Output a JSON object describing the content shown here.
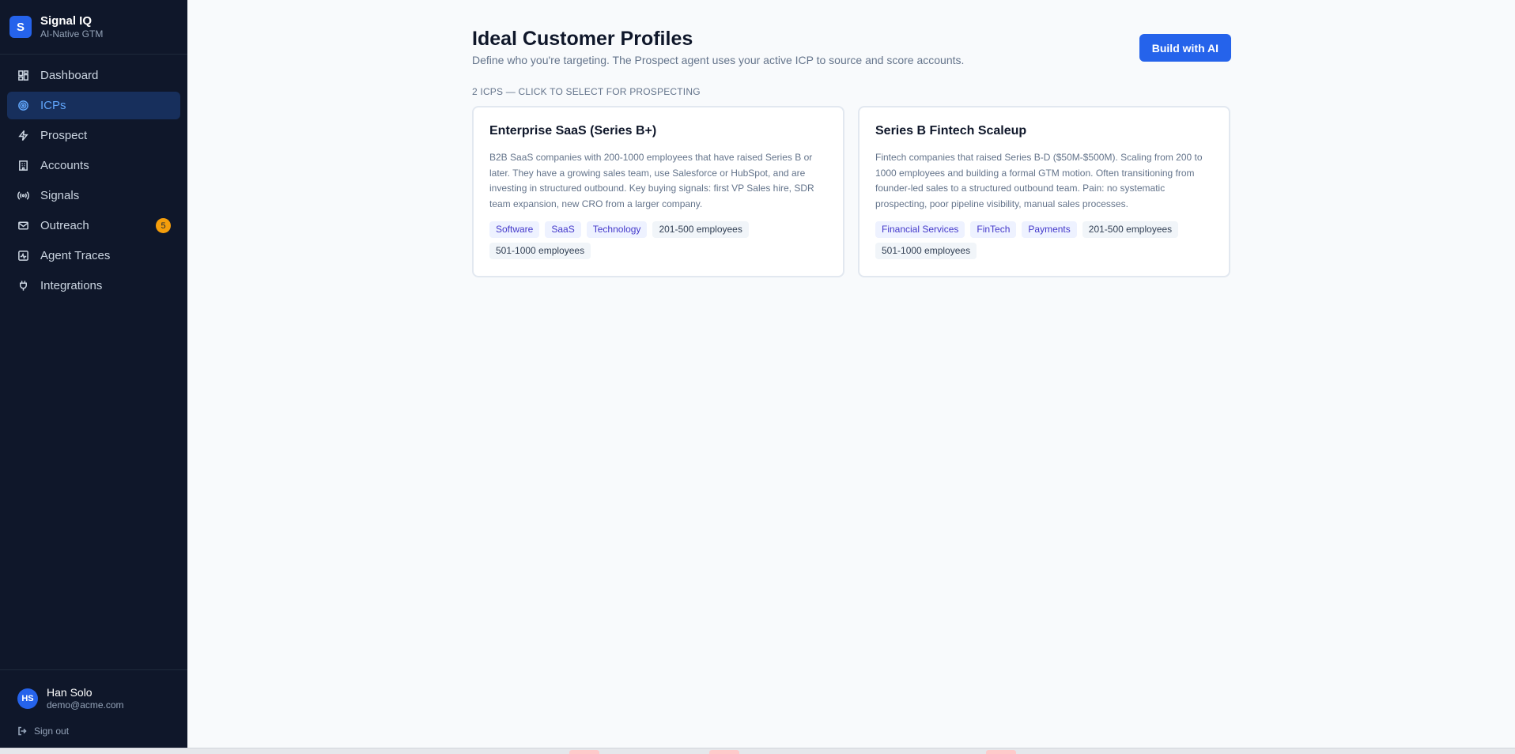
{
  "brand": {
    "logo_letter": "S",
    "name": "Signal IQ",
    "tagline": "AI-Native GTM"
  },
  "nav": [
    {
      "label": "Dashboard",
      "icon": "dashboard-icon",
      "active": false
    },
    {
      "label": "ICPs",
      "icon": "target-icon",
      "active": true
    },
    {
      "label": "Prospect",
      "icon": "bolt-icon",
      "active": false
    },
    {
      "label": "Accounts",
      "icon": "building-icon",
      "active": false
    },
    {
      "label": "Signals",
      "icon": "radio-icon",
      "active": false
    },
    {
      "label": "Outreach",
      "icon": "mail-icon",
      "active": false,
      "badge": "5"
    },
    {
      "label": "Agent Traces",
      "icon": "activity-icon",
      "active": false
    },
    {
      "label": "Integrations",
      "icon": "plug-icon",
      "active": false
    }
  ],
  "user": {
    "initials": "HS",
    "name": "Han Solo",
    "email": "demo@acme.com",
    "signout_label": "Sign out"
  },
  "page": {
    "title": "Ideal Customer Profiles",
    "description": "Define who you're targeting. The Prospect agent uses your active ICP to source and score accounts.",
    "build_button": "Build with AI",
    "section_label": "2 ICPs — click to select for prospecting"
  },
  "icps": [
    {
      "title": "Enterprise SaaS (Series B+)",
      "description": "B2B SaaS companies with 200-1000 employees that have raised Series B or later. They have a growing sales team, use Salesforce or HubSpot, and are investing in structured outbound. Key buying signals: first VP Sales hire, SDR team expansion, new CRO from a larger company.",
      "industry_tags": [
        "Software",
        "SaaS",
        "Technology"
      ],
      "size_tags": [
        "201-500 employees",
        "501-1000 employees"
      ]
    },
    {
      "title": "Series B Fintech Scaleup",
      "description": "Fintech companies that raised Series B-D ($50M-$500M). Scaling from 200 to 1000 employees and building a formal GTM motion. Often transitioning from founder-led sales to a structured outbound team. Pain: no systematic prospecting, poor pipeline visibility, manual sales processes.",
      "industry_tags": [
        "Financial Services",
        "FinTech",
        "Payments"
      ],
      "size_tags": [
        "201-500 employees",
        "501-1000 employees"
      ]
    }
  ],
  "colors": {
    "sidebar_bg": "#0f172a",
    "accent": "#2563eb",
    "active_text": "#60a5fa",
    "badge": "#f59e0b"
  }
}
